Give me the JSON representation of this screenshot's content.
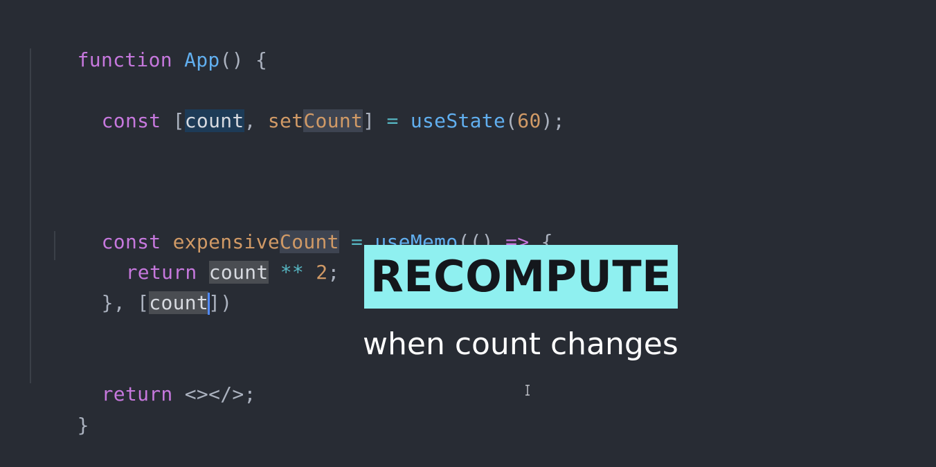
{
  "editor": {
    "lines": {
      "l1": [
        "function",
        " ",
        "App",
        "() {"
      ],
      "l2": [
        "const",
        " [",
        "count",
        ", ",
        "setCount",
        "] ",
        "=",
        " ",
        "useState",
        "(",
        "60",
        ");"
      ],
      "l3": [
        "const",
        " ",
        "expensive",
        "Count",
        " ",
        "=",
        " ",
        "useMemo",
        "(() ",
        "=>",
        " {"
      ],
      "l4": [
        "return",
        " ",
        "count",
        " ",
        "**",
        " ",
        "2",
        ";"
      ],
      "l5": [
        "}, [",
        "count",
        "])"
      ],
      "l6": [
        "return",
        " <></>;"
      ],
      "l7": [
        "}"
      ]
    }
  },
  "overlay": {
    "title": "RECOMPUTE",
    "subtitle": "when count changes"
  },
  "colors": {
    "background": "#282c34",
    "keyword": "#c678dd",
    "function": "#61afef",
    "number": "#d19a66",
    "operator": "#56b6c2",
    "overlay_box": "#8ff0f0"
  },
  "icons": {
    "mouse_cursor": "text-cursor-icon"
  }
}
